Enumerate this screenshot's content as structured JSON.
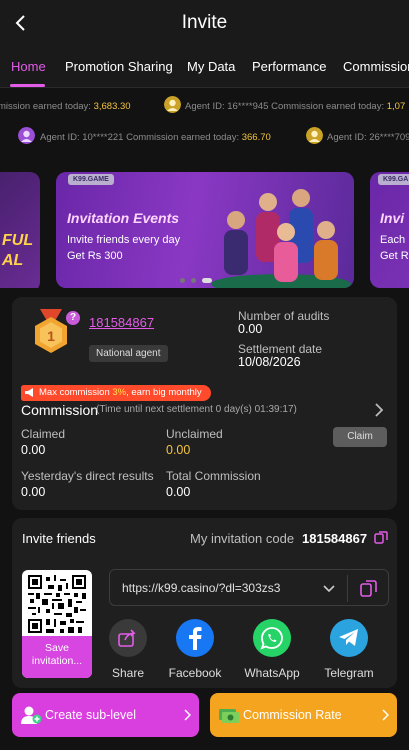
{
  "header": {
    "title": "Invite"
  },
  "tabs": [
    {
      "label": "Home",
      "active": true
    },
    {
      "label": "Promotion Sharing"
    },
    {
      "label": "My Data"
    },
    {
      "label": "Performance"
    },
    {
      "label": "Commission"
    }
  ],
  "ticker": {
    "row1": [
      {
        "text": "mission earned today: ",
        "value": "3,683.30"
      },
      {
        "text": "Agent ID: 16****945 Commission earned today: ",
        "value": "1,07"
      }
    ],
    "row2": [
      {
        "text": "Agent ID: 10****221 Commission earned today: ",
        "value": "366.70"
      },
      {
        "text": "Agent ID: 26****709"
      }
    ]
  },
  "banner": {
    "tag": "K99.GAME",
    "title": "Invitation Events",
    "line1": "Invite friends every day",
    "line2": "Get Rs 300",
    "right_tag": "K99.GA",
    "right_title": "Invi",
    "right_line1": "Each",
    "right_line2": "Get R",
    "left_line1": "FUL",
    "left_line2": "AL"
  },
  "agent": {
    "level": "1",
    "id": "181584867",
    "type": "National agent",
    "audits_label": "Number of audits",
    "audits_value": "0.00",
    "settlement_label": "Settlement date",
    "settlement_value": "10/08/2026"
  },
  "commission": {
    "promo_prefix": "Max commission ",
    "promo_pct": "3%",
    "promo_suffix": ", earn big monthly",
    "title": "Commission",
    "note": "(Time until next settlement  0 day(s) 01:39:17)",
    "claimed_label": "Claimed",
    "claimed_value": "0.00",
    "unclaimed_label": "Unclaimed",
    "unclaimed_value": "0.00",
    "claim_button": "Claim",
    "yesterday_label": "Yesterday's direct results",
    "yesterday_value": "0.00",
    "total_label": "Total Commission",
    "total_value": "0.00"
  },
  "invite": {
    "title": "Invite friends",
    "code_label": "My invitation code",
    "code_value": "181584867",
    "save_label": "Save invitation...",
    "link": "https://k99.casino/?dl=303zs3",
    "share": [
      {
        "label": "Share",
        "icon": "share-icon",
        "color": "#3a3a3a"
      },
      {
        "label": "Facebook",
        "icon": "facebook-icon",
        "color": "#1877f2"
      },
      {
        "label": "WhatsApp",
        "icon": "whatsapp-icon",
        "color": "#25d366"
      },
      {
        "label": "Telegram",
        "icon": "telegram-icon",
        "color": "#2aa3df"
      }
    ]
  },
  "actions": {
    "create_sub_level": "Create sub-level",
    "commission_rate": "Commission Rate"
  },
  "colors": {
    "accent": "#e25ce8",
    "gold": "#f4c43e",
    "promo": "#ff4a2b",
    "orange_button": "#f4a41f"
  }
}
